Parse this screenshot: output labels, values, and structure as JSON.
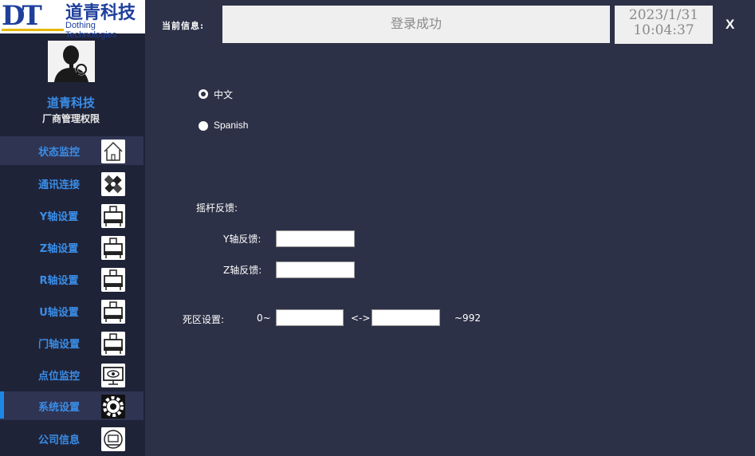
{
  "logo": {
    "mark": "DT",
    "name": "道青科技",
    "name_en": "Dothing Technologies"
  },
  "user": {
    "name": "道青科技",
    "role": "厂商管理权限"
  },
  "nav": [
    {
      "label": "状态监控",
      "icon": "home-icon"
    },
    {
      "label": "通讯连接",
      "icon": "satellite-icon"
    },
    {
      "label": "Y轴设置",
      "icon": "motor-icon"
    },
    {
      "label": "Z轴设置",
      "icon": "motor-icon"
    },
    {
      "label": "R轴设置",
      "icon": "motor-icon"
    },
    {
      "label": "U轴设置",
      "icon": "motor-icon"
    },
    {
      "label": "门轴设置",
      "icon": "motor-icon"
    },
    {
      "label": "点位监控",
      "icon": "monitor-eye-icon"
    },
    {
      "label": "系统设置",
      "icon": "gear-icon",
      "active": true
    },
    {
      "label": "公司信息",
      "icon": "company-icon"
    }
  ],
  "header": {
    "info_label": "当前信息:",
    "info_text": "登录成功",
    "date": "2023/1/31",
    "time": "10:04:37",
    "close_label": "X"
  },
  "language": {
    "options": [
      {
        "label": "中文",
        "selected": false
      },
      {
        "label": "Spanish",
        "selected": true
      }
    ]
  },
  "feedback": {
    "title": "摇杆反馈:",
    "y_label": "Y轴反馈:",
    "y_value": "",
    "z_label": "Z轴反馈:",
    "z_value": ""
  },
  "deadzone": {
    "label": "死区设置:",
    "min_prefix": "0~",
    "separator": "<->",
    "max_suffix": "~992",
    "low_value": "",
    "high_value": ""
  },
  "colors": {
    "accent": "#3a8ee8",
    "background": "#2d3147",
    "sidebar": "#1f2338",
    "active_marker": "#1e88e5"
  }
}
